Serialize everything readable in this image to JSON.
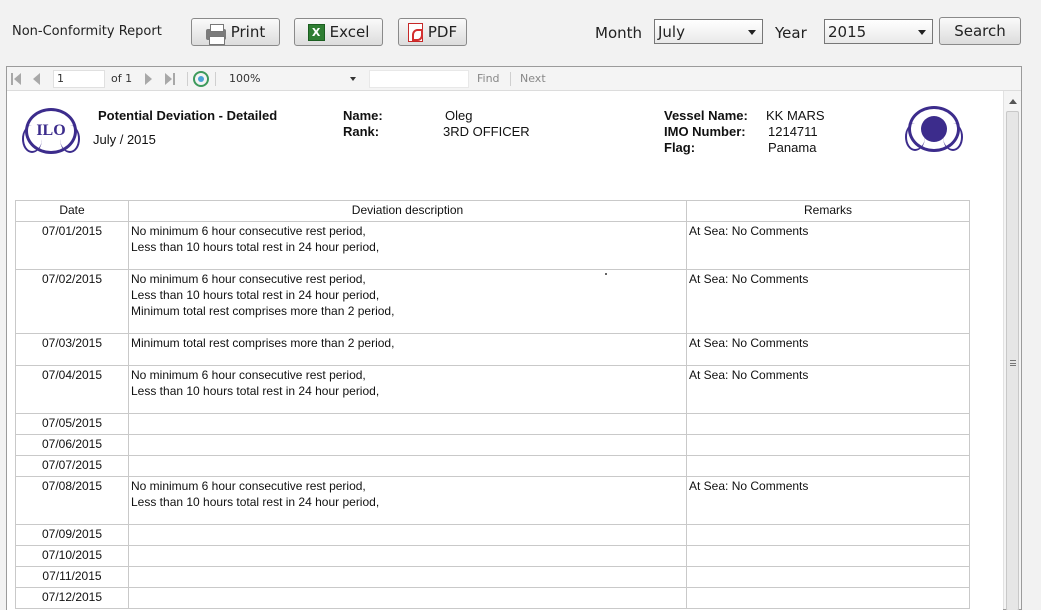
{
  "app_title": "Non-Conformity Report",
  "toolbar": {
    "print_label": "Print",
    "excel_label": "Excel",
    "pdf_label": "PDF",
    "excel_icon_text": "X",
    "month_label": "Month",
    "month_value": "July",
    "year_label": "Year",
    "year_value": "2015",
    "search_label": "Search"
  },
  "viewer": {
    "page_current": "1",
    "page_of": "of 1",
    "zoom": "100%",
    "find_label": "Find",
    "next_label": "Next"
  },
  "report": {
    "title": "Potential Deviation - Detailed",
    "period": "July / 2015",
    "ilo_logo_text": "ILO",
    "name_label": "Name:",
    "name_value": "Oleg",
    "rank_label": "Rank:",
    "rank_value": "3RD OFFICER",
    "vessel_label": "Vessel Name:",
    "vessel_value": "KK MARS",
    "imo_label": "IMO Number:",
    "imo_value": "1214711",
    "flag_label": "Flag:",
    "flag_value": "Panama",
    "columns": [
      "Date",
      "Deviation description",
      "Remarks"
    ],
    "rows": [
      {
        "date": "07/01/2015",
        "lines": [
          "No minimum 6 hour consecutive rest period,",
          "Less than 10 hours total rest in 24 hour period,"
        ],
        "remarks": "At Sea: No Comments"
      },
      {
        "date": "07/02/2015",
        "lines": [
          "No minimum 6 hour consecutive rest period,",
          "Less than 10 hours total rest in 24 hour period,",
          "Minimum total rest comprises more than 2 period,"
        ],
        "remarks": "At Sea: No Comments"
      },
      {
        "date": "07/03/2015",
        "lines": [
          "Minimum total rest comprises more than 2 period,"
        ],
        "remarks": "At Sea: No Comments"
      },
      {
        "date": "07/04/2015",
        "lines": [
          "No minimum 6 hour consecutive rest period,",
          "Less than 10 hours total rest in 24 hour period,"
        ],
        "remarks": "At Sea: No Comments"
      },
      {
        "date": "07/05/2015",
        "lines": [],
        "remarks": ""
      },
      {
        "date": "07/06/2015",
        "lines": [],
        "remarks": ""
      },
      {
        "date": "07/07/2015",
        "lines": [],
        "remarks": ""
      },
      {
        "date": "07/08/2015",
        "lines": [
          "No minimum 6 hour consecutive rest period,",
          "Less than 10 hours total rest in 24 hour period,"
        ],
        "remarks": "At Sea: No Comments"
      },
      {
        "date": "07/09/2015",
        "lines": [],
        "remarks": ""
      },
      {
        "date": "07/10/2015",
        "lines": [],
        "remarks": ""
      },
      {
        "date": "07/11/2015",
        "lines": [],
        "remarks": ""
      },
      {
        "date": "07/12/2015",
        "lines": [],
        "remarks": ""
      }
    ]
  }
}
